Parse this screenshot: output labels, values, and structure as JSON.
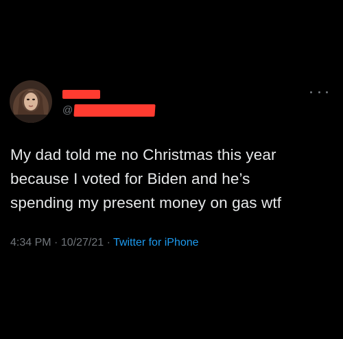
{
  "tweet": {
    "handle_prefix": "@",
    "text_lines": [
      "My dad told me no Christmas this year",
      "because I voted for Biden and he’s",
      "spending my present money on gas wtf"
    ],
    "time": "4:34 PM",
    "separator": "·",
    "date": "10/27/21",
    "source": "Twitter for iPhone"
  },
  "colors": {
    "background": "#000000",
    "text": "#e7e9ea",
    "secondary": "#71767b",
    "link": "#1d9bf0",
    "redaction": "#ff3b30"
  },
  "icons": {
    "more": "more-options-icon"
  }
}
